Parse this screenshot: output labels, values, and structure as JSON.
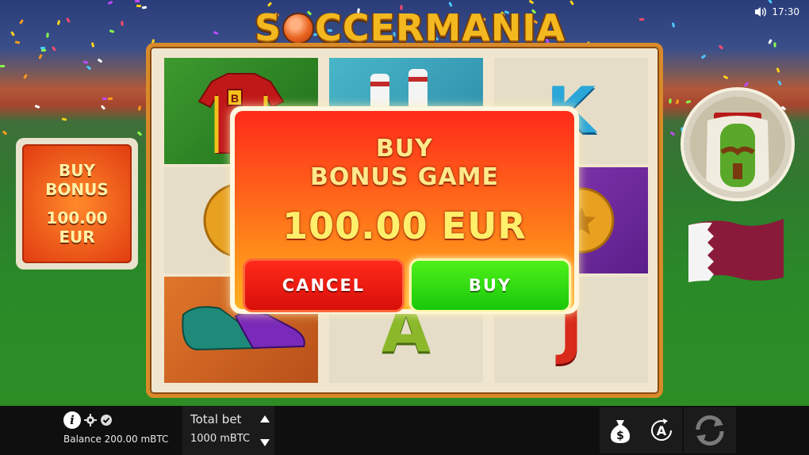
{
  "game": {
    "title_pre": "S",
    "title_post": "CCERMANIA",
    "clock": "17:30"
  },
  "reels": {
    "symbols": [
      {
        "name": "jersey",
        "letter": "B"
      },
      {
        "name": "socks"
      },
      {
        "name": "k-letter",
        "letter": "K"
      },
      {
        "name": "coin"
      },
      {
        "name": "coin"
      },
      {
        "name": "boots"
      },
      {
        "name": "a-letter",
        "letter": "A"
      },
      {
        "name": "j-letter",
        "letter": "J"
      }
    ]
  },
  "side_buy": {
    "line1": "BUY",
    "line2": "BONUS",
    "price": "100.00",
    "currency": "EUR"
  },
  "dialog": {
    "line1": "BUY",
    "line2": "BONUS GAME",
    "price": "100.00 EUR",
    "cancel_label": "CANCEL",
    "buy_label": "BUY"
  },
  "bottom_bar": {
    "balance_text": "Balance 200.00 mBTC",
    "total_bet_label": "Total bet",
    "total_bet_value": "1000 mBTC",
    "auto_label": "A"
  },
  "colors": {
    "accent_orange": "#d88a2a",
    "cancel_red": "#e0150c",
    "buy_green": "#2fd810"
  },
  "icons": [
    "speaker-icon",
    "info-icon",
    "gear-icon",
    "shield-check-icon",
    "arrow-up-icon",
    "arrow-down-icon",
    "money-bag-icon",
    "autoplay-icon",
    "spin-icon"
  ]
}
